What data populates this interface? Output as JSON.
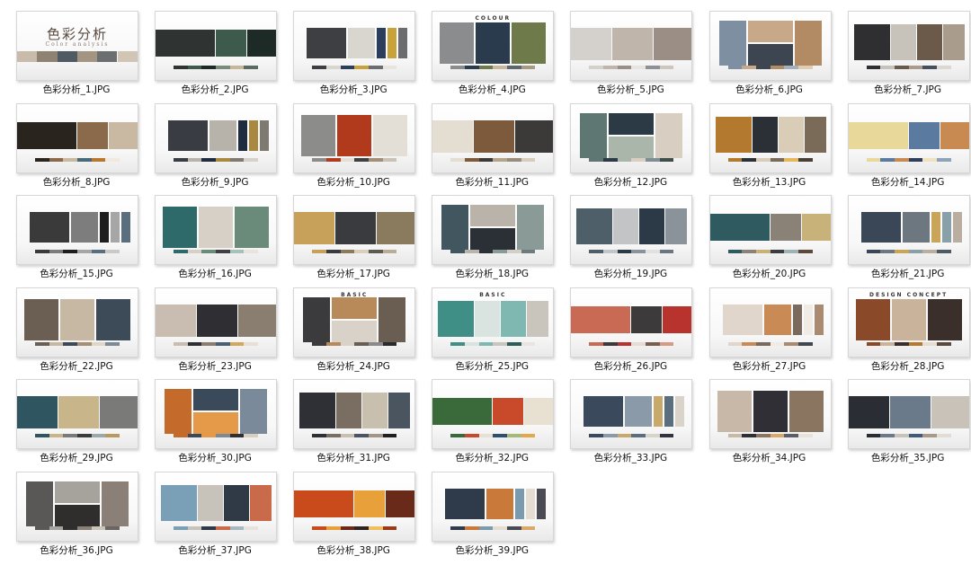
{
  "folder": {
    "items": [
      {
        "name": "色彩分析_1.JPG",
        "title": "色彩分析",
        "subtitle": "Color analysis",
        "colors": [
          "#c9bba9",
          "#8e8273",
          "#4f5a63",
          "#a49482",
          "#6b6f70",
          "#d1c6b6"
        ]
      },
      {
        "name": "色彩分析_2.JPG",
        "colors": [
          "#2f3331",
          "#3d5a4c",
          "#1e2a26",
          "#7a8b7d",
          "#c8b89a",
          "#5b6b5f"
        ]
      },
      {
        "name": "色彩分析_3.JPG",
        "colors": [
          "#3e3f42",
          "#d9d6d0",
          "#2b3f5c",
          "#c7a33a",
          "#6a6c70",
          "#e8e5df"
        ]
      },
      {
        "name": "色彩分析_4.JPG",
        "brand": "COLOUR",
        "colors": [
          "#8a8c8e",
          "#2a3b4e",
          "#6f7a4a",
          "#c7b79c",
          "#5c6770",
          "#a79a85"
        ]
      },
      {
        "name": "色彩分析_5.JPG",
        "colors": [
          "#d4d0cc",
          "#bfb5aa",
          "#9b8f85",
          "#e7e3de",
          "#8e9096",
          "#cfc6bb"
        ]
      },
      {
        "name": "色彩分析_6.JPG",
        "colors": [
          "#7d8fa0",
          "#c7a98a",
          "#3d4650",
          "#b28a64",
          "#a5b0ba",
          "#e1cdb4"
        ]
      },
      {
        "name": "色彩分析_7.JPG",
        "colors": [
          "#2f2f31",
          "#c7c2ba",
          "#6b5a4a",
          "#a99c8c",
          "#44505c",
          "#dcd7cf"
        ]
      },
      {
        "name": "色彩分析_8.JPG",
        "colors": [
          "#2a241f",
          "#8a6a4a",
          "#c9b9a3",
          "#4a6a7a",
          "#b8772f",
          "#efe9e0"
        ]
      },
      {
        "name": "色彩分析_9.JPG",
        "colors": [
          "#3a3c44",
          "#b7b3ab",
          "#1f2c3f",
          "#a8893f",
          "#7e7a72",
          "#d7d2c9"
        ]
      },
      {
        "name": "色彩分析_10.JPG",
        "colors": [
          "#8c8c8a",
          "#b23a1c",
          "#e4dfd6",
          "#3f3f3f",
          "#a38f77",
          "#c9c2b6"
        ]
      },
      {
        "name": "色彩分析_11.JPG",
        "colors": [
          "#e3ddd2",
          "#7d5a3c",
          "#3b3a38",
          "#b5a48c",
          "#9a8c7a",
          "#d6cdbf"
        ]
      },
      {
        "name": "色彩分析_12.JPG",
        "colors": [
          "#5f7772",
          "#2c3a46",
          "#a9b6a9",
          "#d8cfc2",
          "#7f8e95",
          "#3f4e4a"
        ]
      },
      {
        "name": "色彩分析_13.JPG",
        "colors": [
          "#b37a2f",
          "#2b2f36",
          "#d9cdb8",
          "#7a6a58",
          "#e6b85a",
          "#4a3f35"
        ]
      },
      {
        "name": "色彩分析_14.JPG",
        "colors": [
          "#e8d99a",
          "#5a7aa0",
          "#c98a52",
          "#2f3e5a",
          "#f0e2c0",
          "#8fa3b8"
        ]
      },
      {
        "name": "色彩分析_15.JPG",
        "colors": [
          "#3a3a3a",
          "#7d7d7d",
          "#1e1e1e",
          "#a6a6a6",
          "#5a6e7e",
          "#c9c9c9"
        ]
      },
      {
        "name": "色彩分析_16.JPG",
        "colors": [
          "#2f6a6a",
          "#d6d0c6",
          "#6a8a7a",
          "#3f3f44",
          "#a9c1bd",
          "#e8e4dc"
        ]
      },
      {
        "name": "色彩分析_17.JPG",
        "colors": [
          "#c7a05a",
          "#3a3b3f",
          "#8a7a5e",
          "#d9cfbc",
          "#5e5a52",
          "#b8ad98"
        ]
      },
      {
        "name": "色彩分析_18.JPG",
        "colors": [
          "#41565e",
          "#b9b3a9",
          "#2a3036",
          "#8a9a96",
          "#d4cfc6",
          "#6c7b7b"
        ]
      },
      {
        "name": "色彩分析_19.JPG",
        "colors": [
          "#4f5f6a",
          "#c2c4c6",
          "#2b3a46",
          "#8b939a",
          "#e1e1e1",
          "#6a7782"
        ]
      },
      {
        "name": "色彩分析_20.JPG",
        "colors": [
          "#2f5a60",
          "#8a8276",
          "#c9b27a",
          "#3a3c40",
          "#9fb2b3",
          "#5b4a3a"
        ]
      },
      {
        "name": "色彩分析_21.JPG",
        "colors": [
          "#3a4756",
          "#6d7780",
          "#c9a55a",
          "#8aa0a8",
          "#b9aea0",
          "#4e5a66"
        ]
      },
      {
        "name": "色彩分析_22.JPG",
        "colors": [
          "#6b5e52",
          "#c7b8a4",
          "#3d4a58",
          "#a68f74",
          "#e0d6c8",
          "#7a8a98"
        ]
      },
      {
        "name": "色彩分析_23.JPG",
        "colors": [
          "#c8bdb0",
          "#2f2f33",
          "#8a7e70",
          "#4a5e74",
          "#d4a85a",
          "#e6e0d8"
        ]
      },
      {
        "name": "色彩分析_24.JPG",
        "brand": "BASIC",
        "colors": [
          "#3b3b3e",
          "#b88a5a",
          "#d8d2c8",
          "#6a5e52",
          "#8a8a8c",
          "#2a2a2d"
        ]
      },
      {
        "name": "色彩分析_25.JPG",
        "brand": "BASIC",
        "colors": [
          "#3f8f86",
          "#d9e3e0",
          "#7fb8b0",
          "#c9c4bc",
          "#2f5e5a",
          "#e9e6e0"
        ]
      },
      {
        "name": "色彩分析_26.JPG",
        "colors": [
          "#c96a55",
          "#3c3a3a",
          "#b8322e",
          "#e5ddd5",
          "#7a5e50",
          "#d79a84"
        ]
      },
      {
        "name": "色彩分析_27.JPG",
        "colors": [
          "#e0d6cb",
          "#c98a55",
          "#7a6a5e",
          "#f0ebe5",
          "#a88b70",
          "#3f4752"
        ]
      },
      {
        "name": "色彩分析_28.JPG",
        "brand": "DESIGN CONCEPT",
        "colors": [
          "#8a4a2a",
          "#c9b39a",
          "#3a2f2a",
          "#b8782f",
          "#e6ddd0",
          "#5a4a3e"
        ]
      },
      {
        "name": "色彩分析_29.JPG",
        "colors": [
          "#2f5660",
          "#c9b58a",
          "#7a7a78",
          "#3b3b3e",
          "#9aa9ad",
          "#b89a5e"
        ]
      },
      {
        "name": "色彩分析_30.JPG",
        "colors": [
          "#c46a2a",
          "#3a4a5a",
          "#e59a4a",
          "#7a8a9a",
          "#2f2f33",
          "#d9cfc0"
        ]
      },
      {
        "name": "色彩分析_31.JPG",
        "colors": [
          "#2f3036",
          "#7a6e62",
          "#c9bfae",
          "#4a5560",
          "#a2968a",
          "#1f2024"
        ]
      },
      {
        "name": "色彩分析_32.JPG",
        "colors": [
          "#3a6a3a",
          "#c94a2a",
          "#e8e0d0",
          "#2f4f6a",
          "#a8b87a",
          "#e4a84a"
        ]
      },
      {
        "name": "色彩分析_33.JPG",
        "colors": [
          "#3a4a5c",
          "#8a9aa8",
          "#c9a96a",
          "#5a6e7e",
          "#d9d3ca",
          "#2f3440"
        ]
      },
      {
        "name": "色彩分析_34.JPG",
        "colors": [
          "#c7b8a8",
          "#2f2f35",
          "#8a7560",
          "#d6a86a",
          "#5a5e66",
          "#e8e2da"
        ]
      },
      {
        "name": "色彩分析_35.JPG",
        "colors": [
          "#2a2d33",
          "#6a7a8a",
          "#c9c2b8",
          "#3f5a7a",
          "#a89a88",
          "#e1ddd6"
        ]
      },
      {
        "name": "色彩分析_36.JPG",
        "colors": [
          "#5a5856",
          "#a6a29c",
          "#2f2e2d",
          "#8a8078",
          "#c9c4bc",
          "#6a6560"
        ]
      },
      {
        "name": "色彩分析_37.JPG",
        "colors": [
          "#7aa0b8",
          "#c7c2ba",
          "#2f3a46",
          "#c96a4a",
          "#a8b8c2",
          "#e6e2dc"
        ]
      },
      {
        "name": "色彩分析_38.JPG",
        "colors": [
          "#c94a1a",
          "#e8a03a",
          "#6a2a1a",
          "#2f2420",
          "#f0c060",
          "#9a3a1a"
        ]
      },
      {
        "name": "色彩分析_39.JPG",
        "colors": [
          "#2f3a4a",
          "#c97a3a",
          "#7a9ab0",
          "#e5ddd2",
          "#4a4a52",
          "#d9a86a"
        ]
      }
    ]
  }
}
